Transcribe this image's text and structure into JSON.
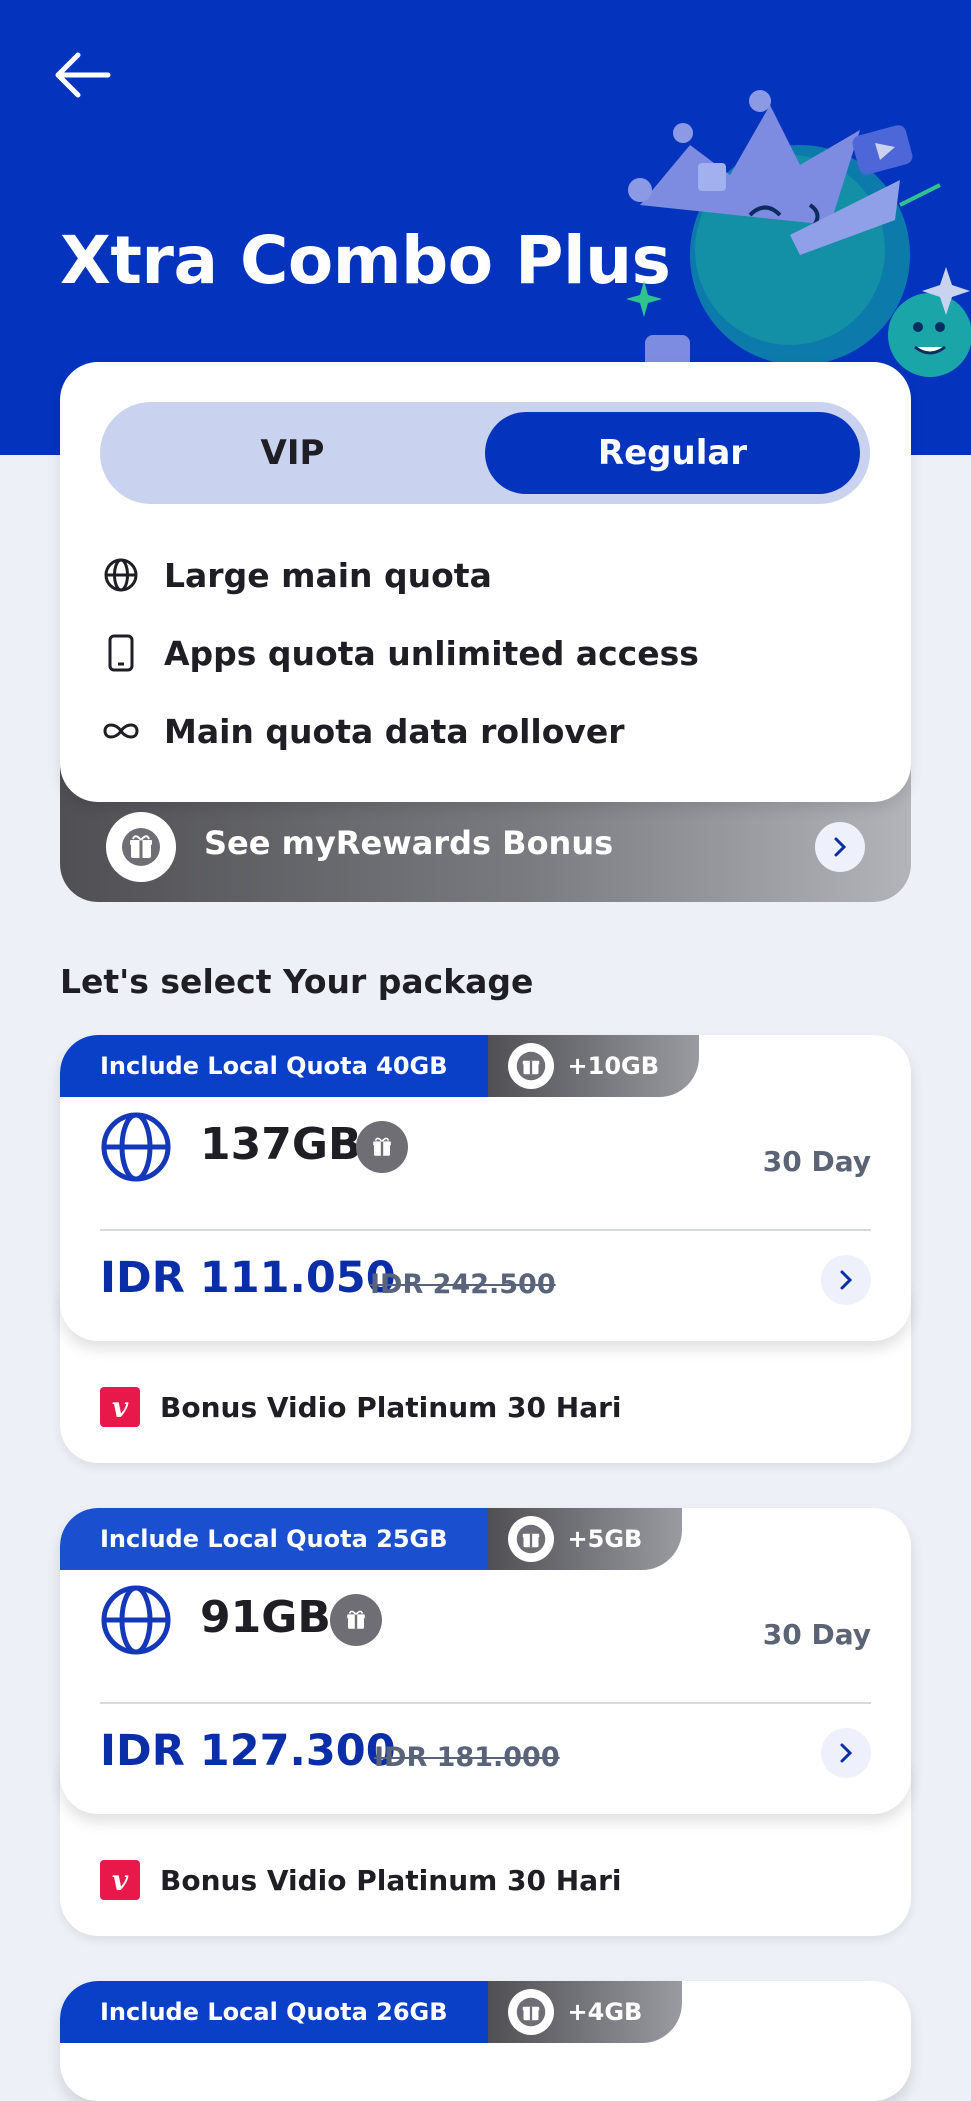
{
  "header": {
    "title": "Xtra Combo Plus",
    "back_icon": "arrow-left-icon",
    "bg_color": "#0434be"
  },
  "toggle": {
    "options": [
      "VIP",
      "Regular"
    ],
    "selected": "Regular"
  },
  "features": [
    {
      "icon": "globe-icon",
      "label": "Large main quota"
    },
    {
      "icon": "phone-icon",
      "label": "Apps quota unlimited access"
    },
    {
      "icon": "infinity-icon",
      "label": "Main quota data rollover"
    }
  ],
  "rewards": {
    "label": "See myRewards Bonus",
    "icon": "gift-icon"
  },
  "section_title": "Let's select Your package",
  "packages": [
    {
      "tag": "Include Local Quota 40GB",
      "bonus_tag": "+10GB",
      "quota": "137GB",
      "days": "30 Day",
      "price": "IDR 111.050",
      "old_price": "IDR 242.500",
      "bonus": "Bonus Vidio Platinum 30 Hari"
    },
    {
      "tag": "Include Local Quota 25GB",
      "bonus_tag": "+5GB",
      "quota": "91GB",
      "days": "30 Day",
      "price": "IDR 127.300",
      "old_price": "IDR 181.000",
      "bonus": "Bonus Vidio Platinum 30 Hari"
    },
    {
      "tag": "Include Local Quota 26GB",
      "bonus_tag": "+4GB"
    }
  ],
  "colors": {
    "accent": "#0434be",
    "tag_blue": "#1a4fd0",
    "price": "#0a2ea8",
    "vidio": "#e8194a"
  }
}
